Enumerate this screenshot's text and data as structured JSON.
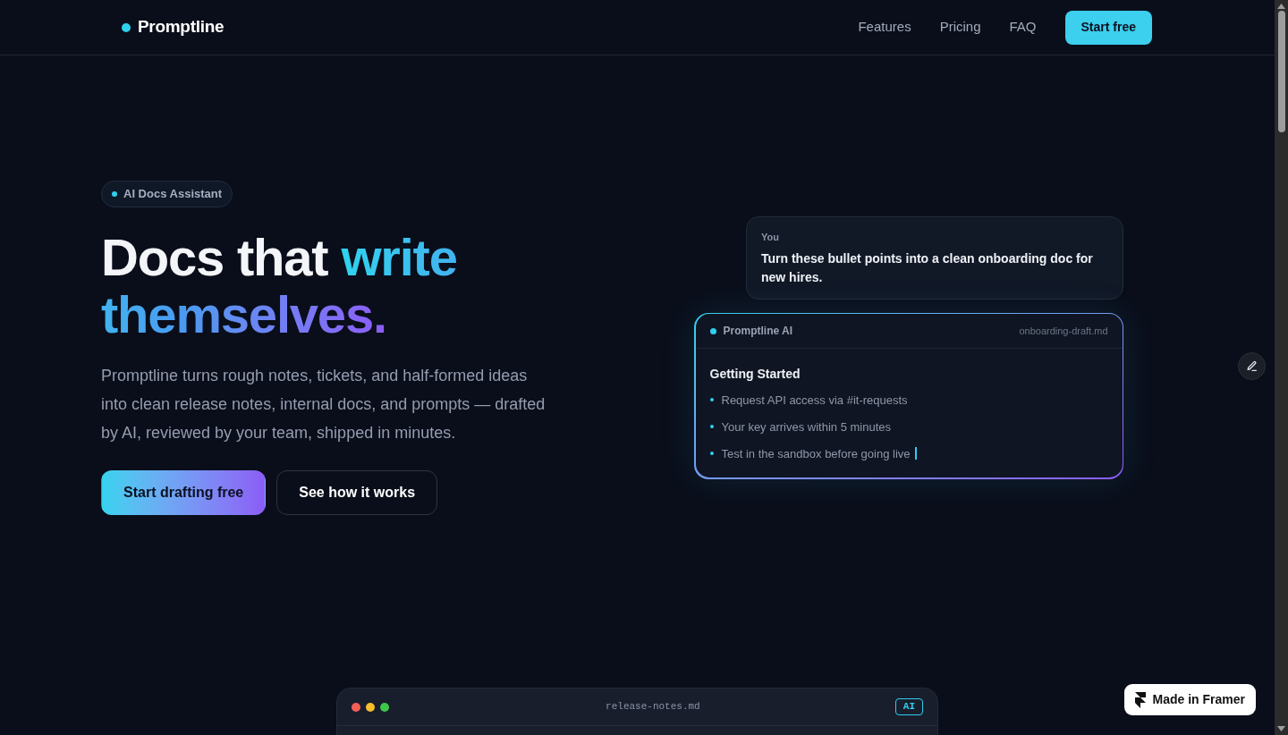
{
  "nav": {
    "brand": "Promptline",
    "links": [
      "Features",
      "Pricing",
      "FAQ"
    ],
    "cta": "Start free"
  },
  "hero": {
    "badge": "AI Docs Assistant",
    "heading": {
      "text": "Docs that",
      "highlight": "write themselves."
    },
    "description": "Promptline turns rough notes, tickets, and half-formed ideas into clean release notes, internal docs, and prompts — drafted by AI, reviewed by your team, shipped in minutes.",
    "buttons": [
      {
        "label": "Start drafting free",
        "kind": "primary"
      },
      {
        "label": "See how it works",
        "kind": "secondary"
      }
    ]
  },
  "chat": {
    "user": {
      "sender": "You",
      "message": "Turn these bullet points into a clean onboarding doc for new hires."
    },
    "reply": {
      "sender": "Promptline AI",
      "file": "onboarding-draft.md",
      "title": "Getting Started",
      "items": [
        "Request API access via #it-requests",
        "Your key arrives within 5 minutes",
        "Test in the sandbox before going live"
      ],
      "typing": true
    }
  },
  "editor_window": {
    "filename": "release-notes.md",
    "badge": "AI"
  },
  "framer_badge": "Made in Framer"
}
